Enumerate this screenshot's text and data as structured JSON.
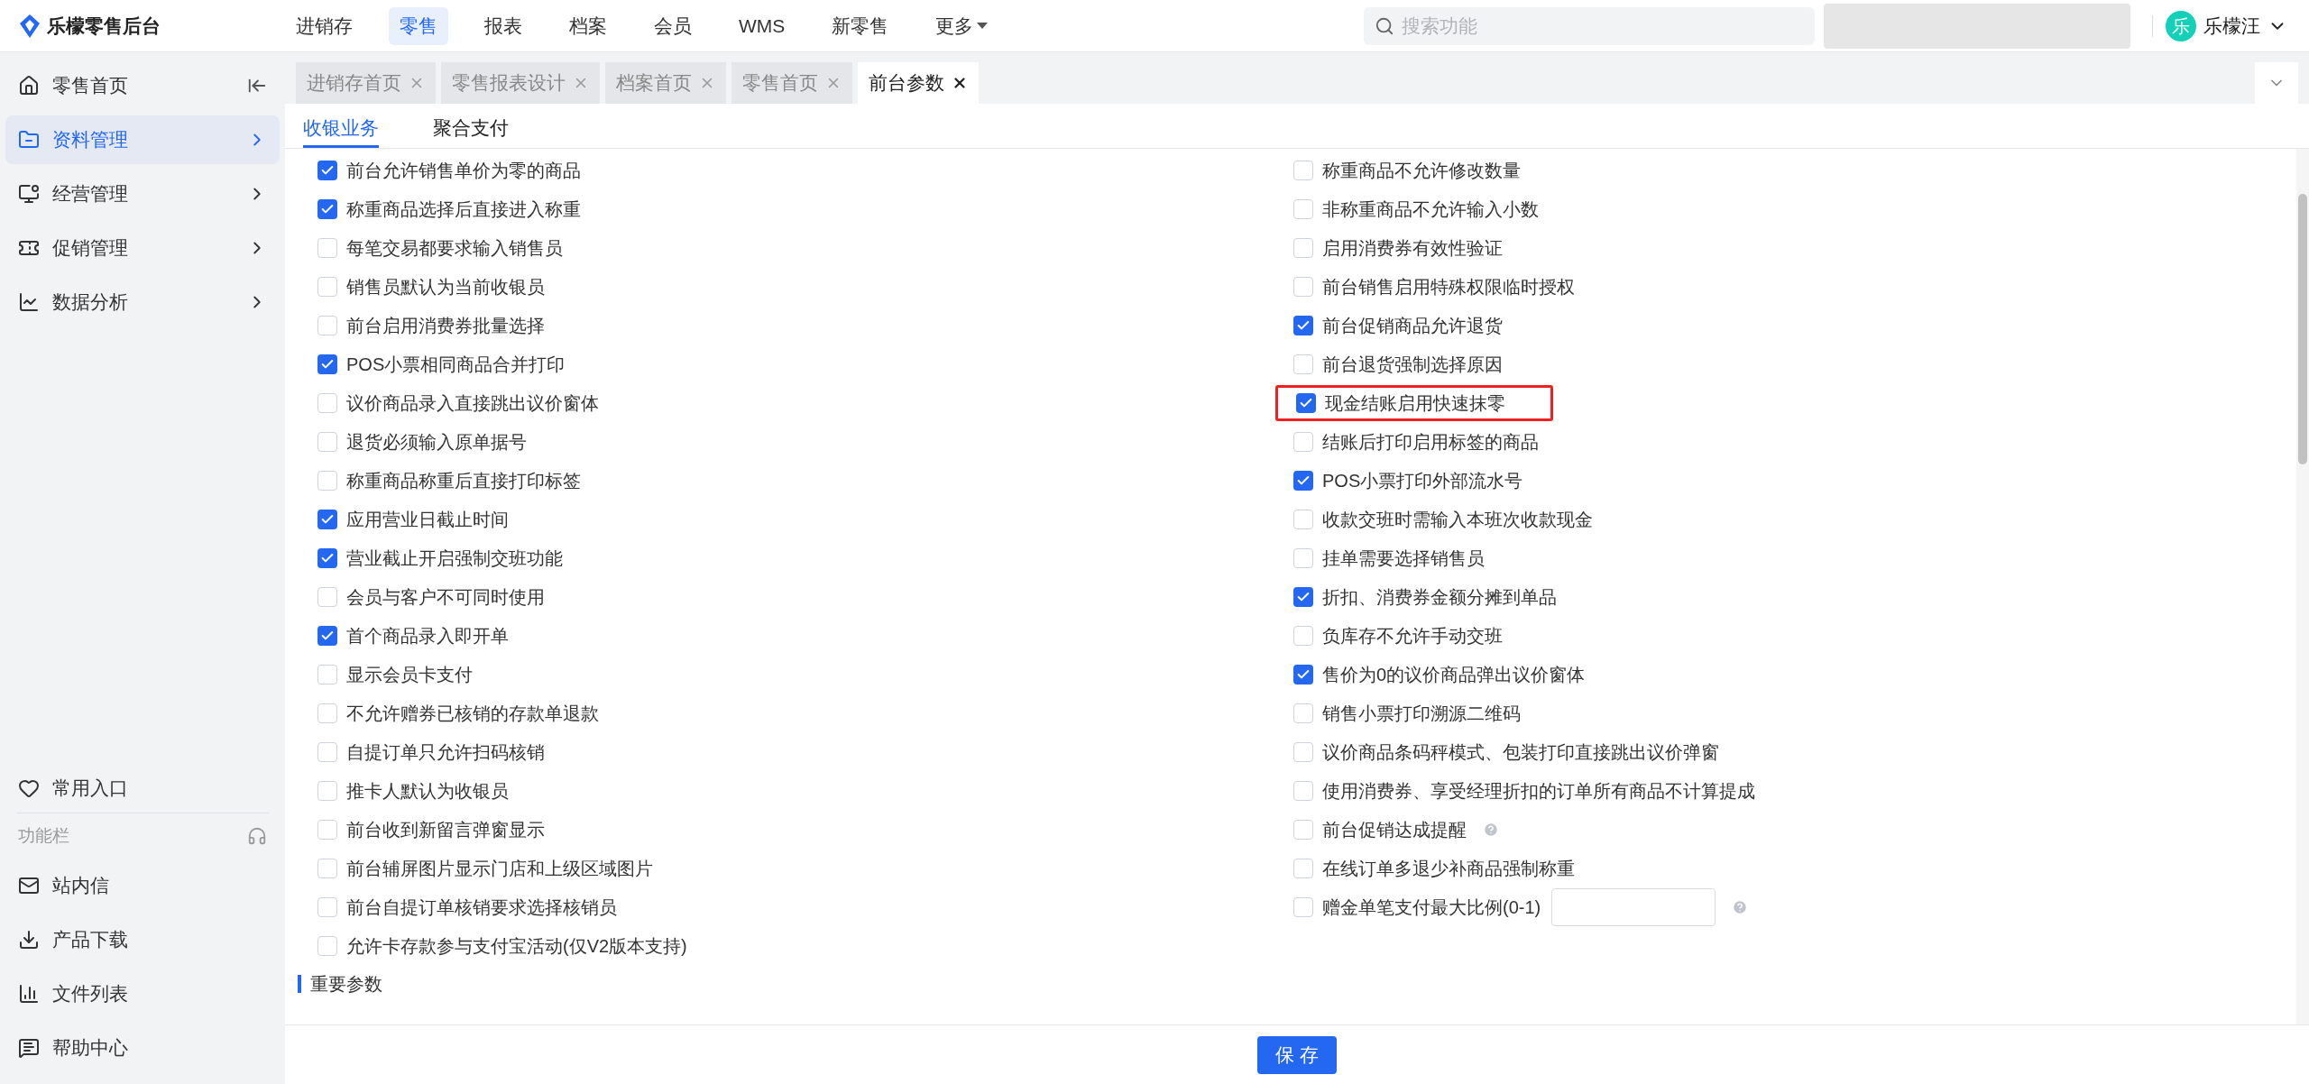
{
  "brand": {
    "name": "乐檬零售后台"
  },
  "top_nav": [
    {
      "label": "进销存",
      "selected": false,
      "dropdown": false
    },
    {
      "label": "零售",
      "selected": true,
      "dropdown": false
    },
    {
      "label": "报表",
      "selected": false,
      "dropdown": false
    },
    {
      "label": "档案",
      "selected": false,
      "dropdown": false
    },
    {
      "label": "会员",
      "selected": false,
      "dropdown": false
    },
    {
      "label": "WMS",
      "selected": false,
      "dropdown": false
    },
    {
      "label": "新零售",
      "selected": false,
      "dropdown": false
    },
    {
      "label": "更多",
      "selected": false,
      "dropdown": true
    }
  ],
  "search": {
    "placeholder": "搜索功能"
  },
  "user": {
    "avatar": "乐",
    "name": "乐檬汪"
  },
  "sidebar": {
    "items": [
      {
        "label": "零售首页",
        "selected": false,
        "kind": "collapse"
      },
      {
        "label": "资料管理",
        "selected": true,
        "kind": "menu"
      },
      {
        "label": "经营管理",
        "selected": false,
        "kind": "menu"
      },
      {
        "label": "促销管理",
        "selected": false,
        "kind": "menu"
      },
      {
        "label": "数据分析",
        "selected": false,
        "kind": "menu"
      }
    ],
    "favorites": "常用入口",
    "toolbar_title": "功能栏",
    "tools": [
      {
        "label": "站内信"
      },
      {
        "label": "产品下载"
      },
      {
        "label": "文件列表"
      },
      {
        "label": "帮助中心"
      }
    ]
  },
  "page_tabs": [
    {
      "label": "进销存首页",
      "selected": false
    },
    {
      "label": "零售报表设计",
      "selected": false
    },
    {
      "label": "档案首页",
      "selected": false
    },
    {
      "label": "零售首页",
      "selected": false
    },
    {
      "label": "前台参数",
      "selected": true
    }
  ],
  "sub_tabs": [
    {
      "label": "收银业务",
      "selected": true
    },
    {
      "label": "聚合支付",
      "selected": false
    }
  ],
  "settings": {
    "left": [
      {
        "label": "前台允许销售单价为零的商品",
        "checked": true
      },
      {
        "label": "称重商品选择后直接进入称重",
        "checked": true
      },
      {
        "label": "每笔交易都要求输入销售员",
        "checked": false
      },
      {
        "label": "销售员默认为当前收银员",
        "checked": false
      },
      {
        "label": "前台启用消费券批量选择",
        "checked": false
      },
      {
        "label": "POS小票相同商品合并打印",
        "checked": true
      },
      {
        "label": "议价商品录入直接跳出议价窗体",
        "checked": false
      },
      {
        "label": "退货必须输入原单据号",
        "checked": false
      },
      {
        "label": "称重商品称重后直接打印标签",
        "checked": false
      },
      {
        "label": "应用营业日截止时间",
        "checked": true
      },
      {
        "label": "营业截止开启强制交班功能",
        "checked": true
      },
      {
        "label": "会员与客户不可同时使用",
        "checked": false
      },
      {
        "label": "首个商品录入即开单",
        "checked": true
      },
      {
        "label": "显示会员卡支付",
        "checked": false
      },
      {
        "label": "不允许赠券已核销的存款单退款",
        "checked": false
      },
      {
        "label": "自提订单只允许扫码核销",
        "checked": false
      },
      {
        "label": "推卡人默认为收银员",
        "checked": false
      },
      {
        "label": "前台收到新留言弹窗显示",
        "checked": false
      },
      {
        "label": "前台辅屏图片显示门店和上级区域图片",
        "checked": false
      },
      {
        "label": "前台自提订单核销要求选择核销员",
        "checked": false
      },
      {
        "label": "允许卡存款参与支付宝活动(仅V2版本支持)",
        "checked": false
      }
    ],
    "right": [
      {
        "label": "称重商品不允许修改数量",
        "checked": false,
        "highlighted": false,
        "help": false,
        "kind": "checkbox"
      },
      {
        "label": "非称重商品不允许输入小数",
        "checked": false,
        "highlighted": false,
        "help": false,
        "kind": "checkbox"
      },
      {
        "label": "启用消费券有效性验证",
        "checked": false,
        "highlighted": false,
        "help": false,
        "kind": "checkbox"
      },
      {
        "label": "前台销售启用特殊权限临时授权",
        "checked": false,
        "highlighted": false,
        "help": false,
        "kind": "checkbox"
      },
      {
        "label": "前台促销商品允许退货",
        "checked": true,
        "highlighted": false,
        "help": false,
        "kind": "checkbox"
      },
      {
        "label": "前台退货强制选择原因",
        "checked": false,
        "highlighted": false,
        "help": false,
        "kind": "checkbox"
      },
      {
        "label": "现金结账启用快速抹零",
        "checked": true,
        "highlighted": true,
        "help": false,
        "kind": "checkbox"
      },
      {
        "label": "结账后打印启用标签的商品",
        "checked": false,
        "highlighted": false,
        "help": false,
        "kind": "checkbox"
      },
      {
        "label": "POS小票打印外部流水号",
        "checked": true,
        "highlighted": false,
        "help": false,
        "kind": "checkbox"
      },
      {
        "label": "收款交班时需输入本班次收款现金",
        "checked": false,
        "highlighted": false,
        "help": false,
        "kind": "checkbox"
      },
      {
        "label": "挂单需要选择销售员",
        "checked": false,
        "highlighted": false,
        "help": false,
        "kind": "checkbox"
      },
      {
        "label": "折扣、消费券金额分摊到单品",
        "checked": true,
        "highlighted": false,
        "help": false,
        "kind": "checkbox"
      },
      {
        "label": "负库存不允许手动交班",
        "checked": false,
        "highlighted": false,
        "help": false,
        "kind": "checkbox"
      },
      {
        "label": "售价为0的议价商品弹出议价窗体",
        "checked": true,
        "highlighted": false,
        "help": false,
        "kind": "checkbox"
      },
      {
        "label": "销售小票打印溯源二维码",
        "checked": false,
        "highlighted": false,
        "help": false,
        "kind": "checkbox"
      },
      {
        "label": "议价商品条码秤模式、包装打印直接跳出议价弹窗",
        "checked": false,
        "highlighted": false,
        "help": false,
        "kind": "checkbox"
      },
      {
        "label": "使用消费券、享受经理折扣的订单所有商品不计算提成",
        "checked": false,
        "highlighted": false,
        "help": false,
        "kind": "checkbox"
      },
      {
        "label": "前台促销达成提醒",
        "checked": false,
        "highlighted": false,
        "help": true,
        "kind": "checkbox"
      },
      {
        "label": "在线订单多退少补商品强制称重",
        "checked": false,
        "highlighted": false,
        "help": false,
        "kind": "checkbox"
      },
      {
        "label": "赠金单笔支付最大比例(0-1)",
        "checked": false,
        "highlighted": false,
        "help": true,
        "kind": "input"
      }
    ]
  },
  "section_heading": "重要参数",
  "save_button": "保 存"
}
